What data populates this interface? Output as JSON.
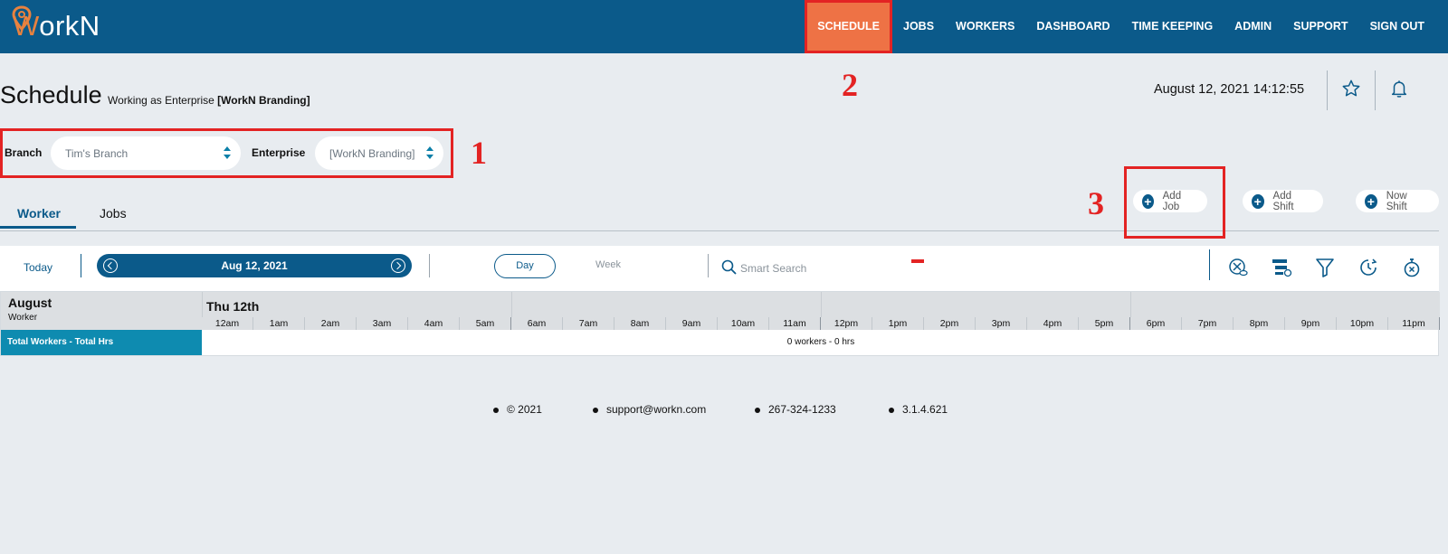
{
  "brand": {
    "logo_letter": "W",
    "logo_rest": "orkN"
  },
  "nav": [
    {
      "label": "SCHEDULE",
      "active": true
    },
    {
      "label": "JOBS"
    },
    {
      "label": "WORKERS"
    },
    {
      "label": "DASHBOARD"
    },
    {
      "label": "TIME KEEPING"
    },
    {
      "label": "ADMIN"
    },
    {
      "label": "SUPPORT"
    },
    {
      "label": "SIGN OUT"
    }
  ],
  "page": {
    "title": "Schedule",
    "subtitle_prefix": "Working as Enterprise ",
    "subtitle_enterprise": "[WorkN Branding]",
    "datetime": "August 12, 2021 14:12:55"
  },
  "filters": {
    "branch_label": "Branch",
    "branch_value": "Tim's Branch",
    "enterprise_label": "Enterprise",
    "enterprise_value": "[WorkN Branding]"
  },
  "actions": {
    "add_job": "Add Job",
    "add_shift": "Add Shift",
    "now_shift": "Now Shift"
  },
  "tabs": [
    {
      "label": "Worker",
      "active": true
    },
    {
      "label": "Jobs"
    }
  ],
  "toolbar": {
    "today": "Today",
    "date": "Aug 12, 2021",
    "view_day": "Day",
    "view_week": "Week",
    "search_placeholder": "Smart Search"
  },
  "grid": {
    "month": "August",
    "row_header": "Worker",
    "day": "Thu 12th",
    "hours": [
      "12am",
      "1am",
      "2am",
      "3am",
      "4am",
      "5am",
      "6am",
      "7am",
      "8am",
      "9am",
      "10am",
      "11am",
      "12pm",
      "1pm",
      "2pm",
      "3pm",
      "4pm",
      "5pm",
      "6pm",
      "7pm",
      "8pm",
      "9pm",
      "10pm",
      "11pm"
    ],
    "total_label": "Total Workers - Total Hrs",
    "total_value": "0 workers - 0 hrs"
  },
  "footer": {
    "copyright": "© 2021",
    "email": "support@workn.com",
    "phone": "267-324-1233",
    "version": "3.1.4.621"
  },
  "annotations": {
    "n1": "1",
    "n2": "2",
    "n3": "3"
  },
  "colors": {
    "primary": "#0b5a8a",
    "accent": "#ee7245",
    "annotation": "#e32323",
    "total_row": "#0e8bb0"
  }
}
